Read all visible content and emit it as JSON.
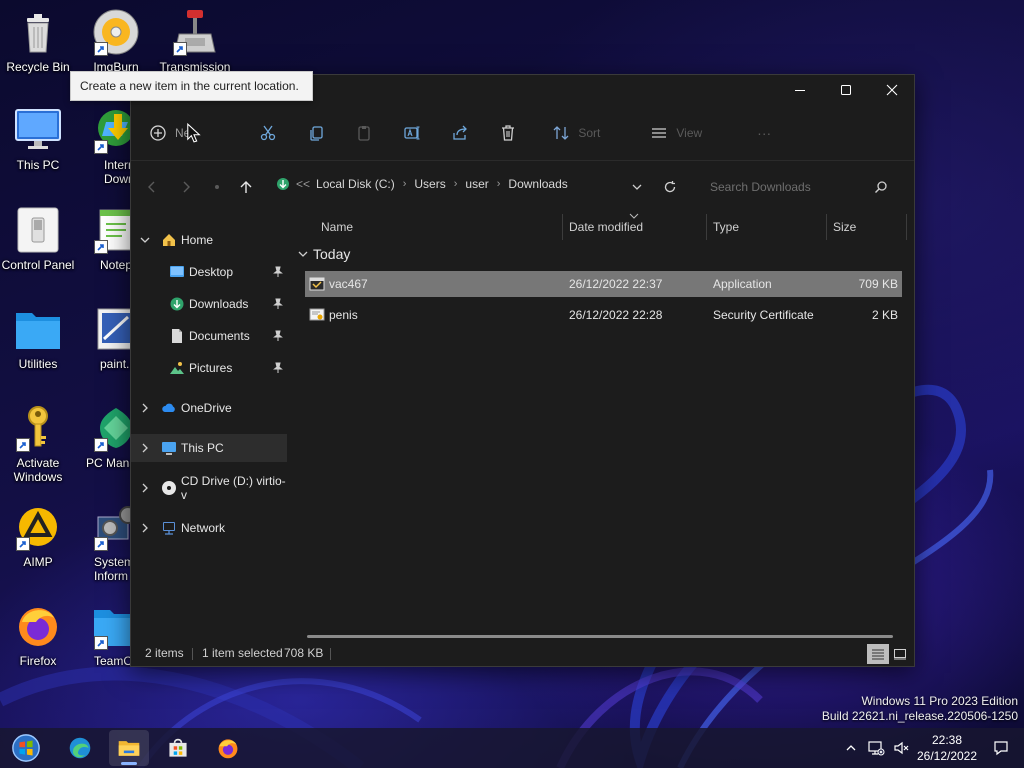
{
  "desktop": {
    "icons_col1": [
      {
        "label": "Recycle Bin",
        "icon": "recycle-bin-icon"
      },
      {
        "label": "This PC",
        "icon": "monitor-icon"
      },
      {
        "label": "Control Panel",
        "icon": "control-panel-icon"
      },
      {
        "label": "Utilities",
        "icon": "folder-icon"
      },
      {
        "label": "Activate Windows",
        "icon": "key-icon"
      },
      {
        "label": "AIMP",
        "icon": "aimp-icon"
      },
      {
        "label": "Firefox",
        "icon": "firefox-icon"
      }
    ],
    "icons_col2": [
      {
        "label": "ImgBurn",
        "icon": "disc-icon"
      },
      {
        "label": "Interne Downlo",
        "icon": "download-manager-icon"
      },
      {
        "label": "Notepac",
        "icon": "notepad-icon"
      },
      {
        "label": "paint.ne",
        "icon": "paint-icon"
      },
      {
        "label": "PC Mana",
        "icon": "pc-manager-icon"
      },
      {
        "label": "System Inform",
        "icon": "system-info-icon"
      },
      {
        "label": "TeamO",
        "icon": "folder-icon"
      }
    ],
    "icons_col3": [
      {
        "label": "Transmission",
        "icon": "transmission-icon"
      }
    ]
  },
  "tooltip": "Create a new item in the current location.",
  "explorer": {
    "toolbar": {
      "new_label": "Ne",
      "sort_label": "Sort",
      "view_label": "View",
      "more_label": "···"
    },
    "breadcrumb": {
      "overflow": "<<",
      "items": [
        "Local Disk (C:)",
        "Users",
        "user",
        "Downloads"
      ]
    },
    "search_placeholder": "Search Downloads",
    "sidebar": {
      "home": "Home",
      "desktop": "Desktop",
      "downloads": "Downloads",
      "documents": "Documents",
      "pictures": "Pictures",
      "onedrive": "OneDrive",
      "thispc": "This PC",
      "cddrive": "CD Drive (D:) virtio-v",
      "network": "Network"
    },
    "columns": {
      "name": "Name",
      "date": "Date modified",
      "type": "Type",
      "size": "Size"
    },
    "group": "Today",
    "files": [
      {
        "name": "vac467",
        "date": "26/12/2022 22:37",
        "type": "Application",
        "size": "709 KB",
        "selected": true
      },
      {
        "name": "penis",
        "date": "26/12/2022 22:28",
        "type": "Security Certificate",
        "size": "2 KB",
        "selected": false
      }
    ],
    "status": {
      "count": "2 items",
      "selection": "1 item selected",
      "selsize": "708 KB"
    }
  },
  "watermark": {
    "line1": "Windows 11 Pro 2023 Edition",
    "line2": "Build 22621.ni_release.220506-1250"
  },
  "taskbar": {
    "time": "22:38",
    "date": "26/12/2022"
  },
  "colors": {
    "accent": "#8ab4ff",
    "selected_row": "#777777",
    "window_bg": "#1c1c1c"
  }
}
